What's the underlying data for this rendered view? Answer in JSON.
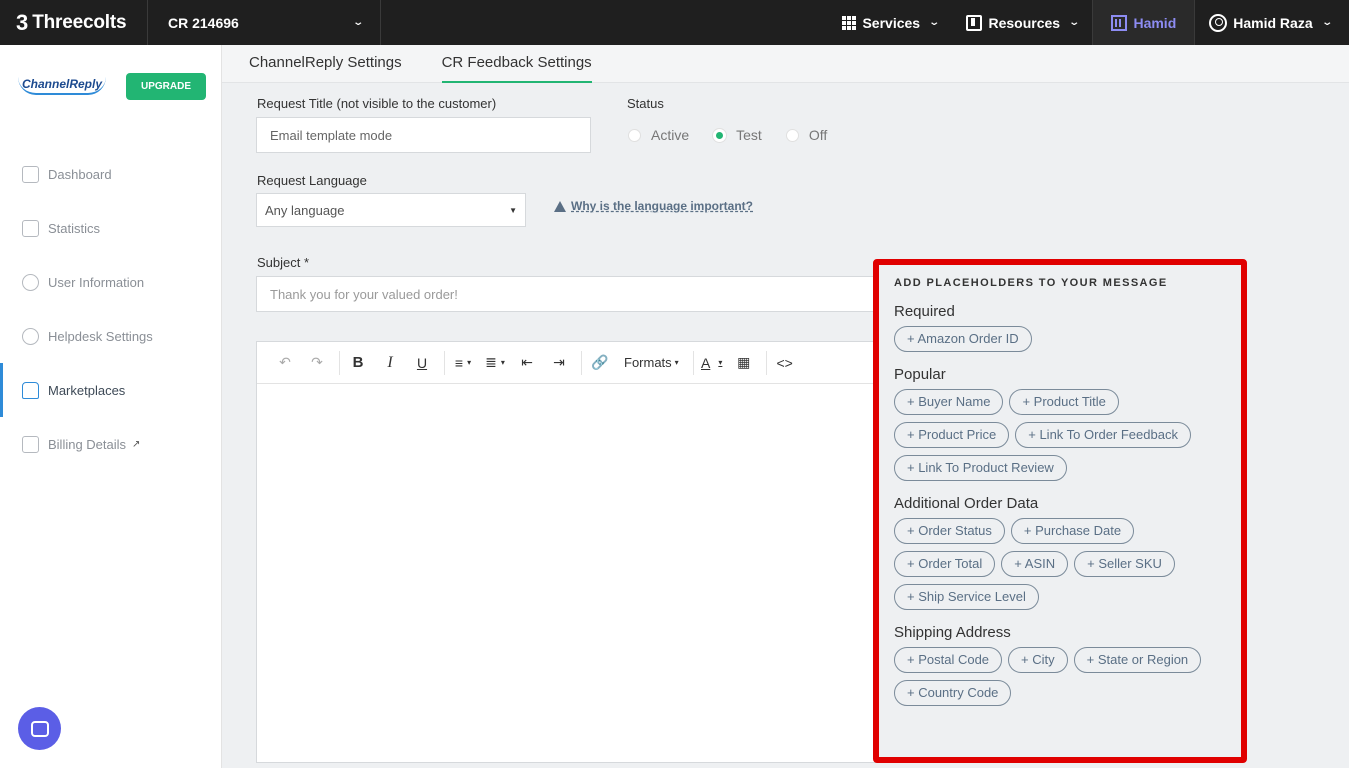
{
  "topbar": {
    "brand_mark": "3",
    "brand_name": "Threecolts",
    "account": "CR 214696",
    "services": "Services",
    "resources": "Resources",
    "org": "Hamid",
    "user": "Hamid Raza"
  },
  "sidebar": {
    "logo": "ChannelReply",
    "upgrade": "UPGRADE",
    "items": [
      {
        "label": "Dashboard"
      },
      {
        "label": "Statistics"
      },
      {
        "label": "User Information"
      },
      {
        "label": "Helpdesk Settings"
      },
      {
        "label": "Marketplaces"
      },
      {
        "label": "Billing Details"
      }
    ]
  },
  "tabs": [
    {
      "label": "ChannelReply Settings"
    },
    {
      "label": "CR Feedback Settings"
    }
  ],
  "form": {
    "request_title_label": "Request Title (not visible to the customer)",
    "request_title_value": "Email template mode",
    "status_label": "Status",
    "status_options": [
      "Active",
      "Test",
      "Off"
    ],
    "language_label": "Request Language",
    "language_value": "Any language",
    "language_help": "Why is the language important?",
    "subject_label": "Subject *",
    "subject_placeholder": "Thank you for your valued order!"
  },
  "editor": {
    "formats_label": "Formats"
  },
  "placeholders": {
    "title": "ADD PLACEHOLDERS TO YOUR MESSAGE",
    "sections": [
      {
        "name": "Required",
        "chips": [
          "+ Amazon Order ID"
        ]
      },
      {
        "name": "Popular",
        "chips": [
          "+ Buyer Name",
          "+ Product Title",
          "+ Product Price",
          "+ Link To Order Feedback",
          "+ Link To Product Review"
        ]
      },
      {
        "name": "Additional Order Data",
        "chips": [
          "+ Order Status",
          "+ Purchase Date",
          "+ Order Total",
          "+ ASIN",
          "+ Seller SKU",
          "+ Ship Service Level"
        ]
      },
      {
        "name": "Shipping Address",
        "chips": [
          "+ Postal Code",
          "+ City",
          "+ State or Region",
          "+ Country Code"
        ]
      }
    ]
  }
}
